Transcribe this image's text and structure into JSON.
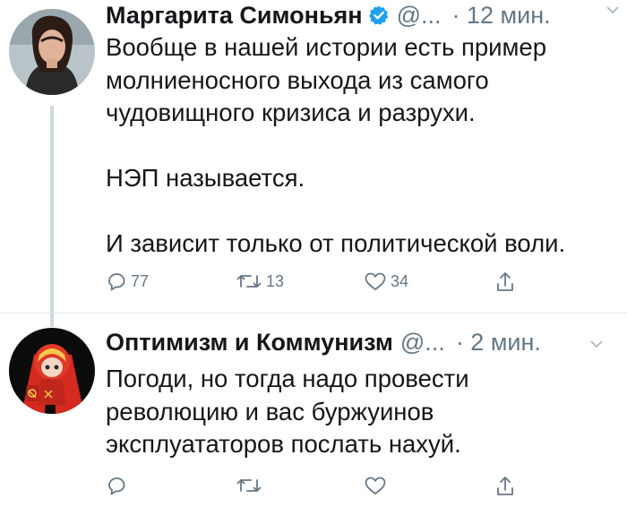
{
  "tweets": [
    {
      "author_name": "Маргарита Симоньян",
      "handle": "@...",
      "time": "· 12 мин.",
      "verified": true,
      "paragraphs": [
        [
          "Вообще в нашей истории есть пример",
          "молниеносного выхода из самого",
          "чудовищного кризиса и разрухи."
        ],
        [
          "НЭП называется."
        ],
        [
          "И зависит только от политической воли."
        ]
      ],
      "replies": "77",
      "retweets": "13",
      "likes": "34"
    },
    {
      "author_name": "Оптимизм и Коммунизм",
      "handle": "@...",
      "time": "· 2 мин.",
      "verified": false,
      "paragraphs": [
        [
          "Погоди, но тогда надо провести",
          "революцию и вас буржуинов",
          "эксплуататоров послать нахуй."
        ]
      ],
      "replies": "",
      "retweets": "",
      "likes": ""
    }
  ],
  "colors": {
    "accent": "#1da1f2",
    "muted": "#657786",
    "thread": "#cfd9de"
  },
  "icons": [
    "verified-badge-icon",
    "reply-icon",
    "retweet-icon",
    "like-icon",
    "share-icon",
    "chevron-down-icon"
  ]
}
